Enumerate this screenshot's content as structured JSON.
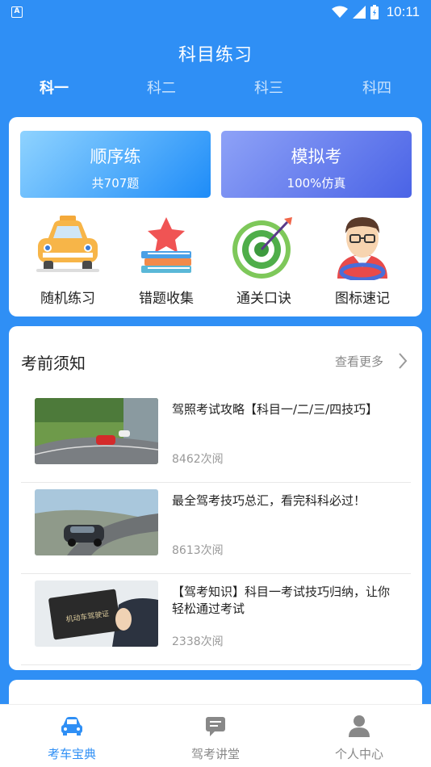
{
  "status_bar": {
    "notification_letter": "A",
    "time": "10:11"
  },
  "header": {
    "title": "科目练习",
    "tabs": [
      {
        "label": "科一",
        "active": true
      },
      {
        "label": "科二",
        "active": false
      },
      {
        "label": "科三",
        "active": false
      },
      {
        "label": "科四",
        "active": false
      }
    ]
  },
  "practice": {
    "sequential": {
      "title": "顺序练",
      "subtitle": "共707题"
    },
    "mock": {
      "title": "模拟考",
      "subtitle": "100%仿真"
    },
    "features": [
      {
        "label": "随机练习",
        "icon": "taxi-icon"
      },
      {
        "label": "错题收集",
        "icon": "star-books-icon"
      },
      {
        "label": "通关口诀",
        "icon": "target-icon"
      },
      {
        "label": "图标速记",
        "icon": "driver-icon"
      }
    ]
  },
  "news": {
    "title": "考前须知",
    "more_label": "查看更多",
    "articles": [
      {
        "title": "驾照考试攻略【科目一/二/三/四技巧】",
        "reads": "8462次阅"
      },
      {
        "title": "最全驾考技巧总汇，看完科科必过！",
        "reads": "8613次阅"
      },
      {
        "title": "【驾考知识】科目一考试技巧归纳，让你轻松通过考试",
        "reads": "2338次阅"
      }
    ],
    "card_text": "机动车驾驶证"
  },
  "bottom_nav": [
    {
      "label": "考车宝典",
      "icon": "car-icon",
      "active": true
    },
    {
      "label": "驾考讲堂",
      "icon": "chat-icon",
      "active": false
    },
    {
      "label": "个人中心",
      "icon": "person-icon",
      "active": false
    }
  ],
  "colors": {
    "primary": "#2f8ff5",
    "mock_gradient_end": "#4a63e6",
    "muted_text": "#999999"
  }
}
